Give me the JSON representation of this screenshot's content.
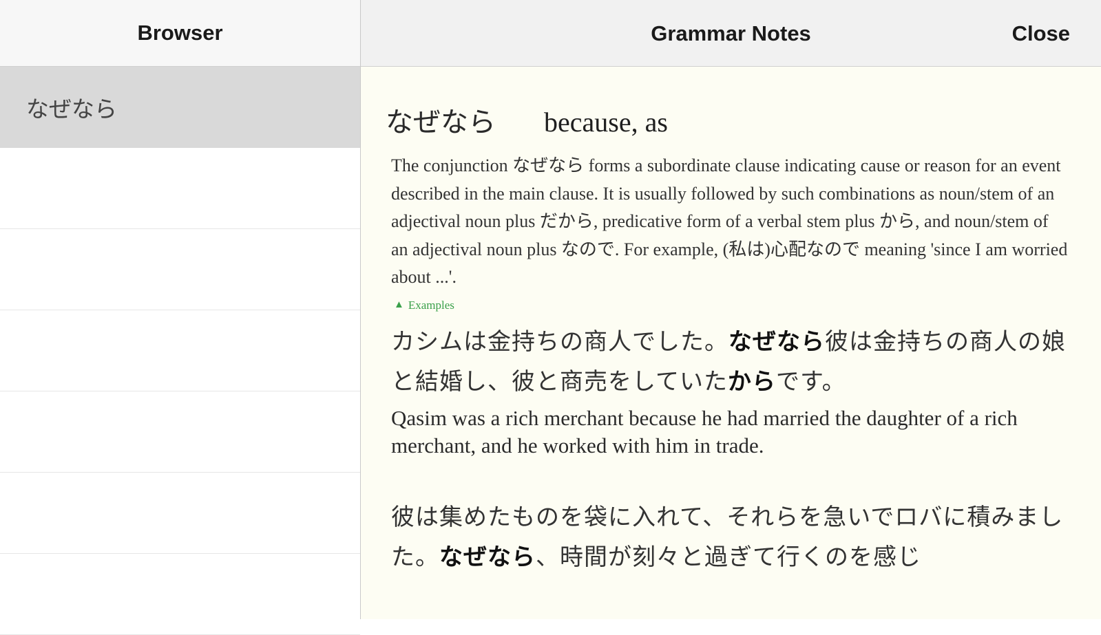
{
  "sidebar": {
    "title": "Browser",
    "items": [
      {
        "label": "なぜなら",
        "selected": true
      },
      {
        "label": ""
      },
      {
        "label": ""
      },
      {
        "label": ""
      },
      {
        "label": ""
      },
      {
        "label": ""
      },
      {
        "label": ""
      }
    ]
  },
  "main": {
    "title": "Grammar Notes",
    "close_label": "Close",
    "entry": {
      "term": "なぜなら",
      "gloss": "because, as",
      "description": "The conjunction なぜなら forms a subordinate clause indicating cause or reason for an event described in the main clause. It is usually followed by such combinations as noun/stem of an adjectival noun plus だから, predicative form of a verbal stem plus から, and noun/stem of an adjectival noun plus なので. For example, (私は)心配なので meaning 'since I am worried about ...'.",
      "examples_label": "Examples",
      "examples": [
        {
          "jp_before": "カシムは金持ちの商人でした。",
          "jp_bold1": "なぜなら",
          "jp_mid": "彼は金持ちの商人の娘と結婚し、彼と商売をしていた",
          "jp_bold2": "から",
          "jp_after": "です。",
          "en": "Qasim was a rich merchant because he had married the daughter of a rich merchant, and he worked with him in trade."
        },
        {
          "jp_before": "彼は集めたものを袋に入れて、それらを急いでロバに積みました。",
          "jp_bold1": "なぜなら",
          "jp_mid": "、時間が刻々と過ぎて行くのを感じ",
          "jp_bold2": "",
          "jp_after": "",
          "en": ""
        }
      ]
    }
  },
  "colors": {
    "content_bg": "#fdfdf3",
    "selected_row": "#d9d9d9",
    "examples_green": "#3aa04a"
  }
}
